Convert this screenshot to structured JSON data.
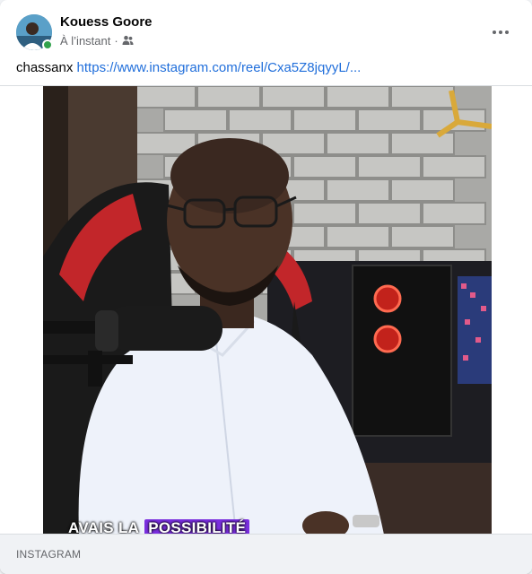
{
  "post": {
    "author": "Kouess Goore",
    "timestamp": "À l’instant",
    "separator": "·",
    "audience_icon": "friends-icon",
    "more_icon": "more-options-icon",
    "text_prefix": "chassanx",
    "link_text": "https://www.instagram.com/reel/Cxa5Z8jqyyL/...",
    "video_caption_plain": "AVAIS LA",
    "video_caption_highlight": "POSSIBILITÉ",
    "link_source": "INSTAGRAM"
  },
  "colors": {
    "link": "#216fdb",
    "online": "#31a24c",
    "caption_highlight": "#7b2fe0",
    "footer_bg": "#f0f2f5"
  }
}
